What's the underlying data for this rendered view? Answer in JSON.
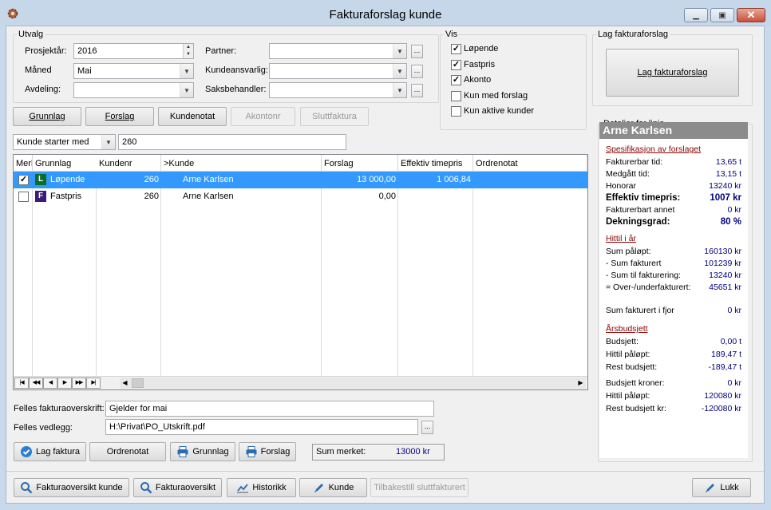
{
  "window": {
    "title": "Fakturaforslag kunde"
  },
  "utvalg": {
    "legend": "Utvalg",
    "prosjektar_label": "Prosjektår:",
    "prosjektar_value": "2016",
    "maned_label": "Måned",
    "maned_value": "Mai",
    "avdeling_label": "Avdeling:",
    "avdeling_value": "",
    "partner_label": "Partner:",
    "partner_value": "",
    "kundeansvarlig_label": "Kundeansvarlig:",
    "kundeansvarlig_value": "",
    "saksbehandler_label": "Saksbehandler:",
    "saksbehandler_value": "",
    "ellipsis": "..."
  },
  "vis": {
    "legend": "Vis",
    "options": [
      {
        "label": "Løpende",
        "checked": true
      },
      {
        "label": "Fastpris",
        "checked": true
      },
      {
        "label": "Akonto",
        "checked": true
      },
      {
        "label": "Kun med forslag",
        "checked": false
      },
      {
        "label": "Kun aktive kunder",
        "checked": false
      }
    ]
  },
  "lag": {
    "legend": "Lag fakturaforslag",
    "button": "Lag fakturaforslag"
  },
  "tabs": {
    "grunnlag": "Grunnlag",
    "forslag": "Forslag",
    "kundenotat": "Kundenotat",
    "akontonr": "Akontonr",
    "sluttfaktura": "Sluttfaktura"
  },
  "filter": {
    "mode": "Kunde starter med",
    "value": "260"
  },
  "grid": {
    "headers": [
      "Merk",
      "Grunnlag",
      "Kundenr",
      ">Kunde",
      "Forslag",
      "Effektiv timepris",
      "Ordrenotat"
    ],
    "rows": [
      {
        "checked": true,
        "tag": "L",
        "tag_color": "#0a6e2a",
        "grunnlag": "Løpende",
        "kundenr": "260",
        "kunde": "Arne Karlsen",
        "forslag": "13 000,00",
        "timepris": "1 006,84",
        "ordrenotat": ""
      },
      {
        "checked": false,
        "tag": "F",
        "tag_color": "#3a1a7a",
        "grunnlag": "Fastpris",
        "kundenr": "260",
        "kunde": "Arne Karlsen",
        "forslag": "0,00",
        "timepris": "",
        "ordrenotat": ""
      }
    ],
    "nav": [
      "|◀",
      "◀◀",
      "◀",
      "▶",
      "▶▶",
      "▶|"
    ]
  },
  "footer_fields": {
    "overskrift_label": "Felles fakturaoverskrift:",
    "overskrift_value": "Gjelder for mai",
    "vedlegg_label": "Felles vedlegg:",
    "vedlegg_value": "H:\\Privat\\PO_Utskrift.pdf"
  },
  "actions": {
    "lag_faktura": "Lag faktura",
    "ordrenotat": "Ordrenotat",
    "grunnlag": "Grunnlag",
    "forslag": "Forslag",
    "sum_label": "Sum merket:",
    "sum_value": "13000 kr"
  },
  "bottom": {
    "fakturaoversikt_kunde": "Fakturaoversikt kunde",
    "fakturaoversikt": "Fakturaoversikt",
    "historikk": "Historikk",
    "kunde": "Kunde",
    "tilbakestill": "Tilbakestill sluttfakturert",
    "lukk": "Lukk"
  },
  "details": {
    "legend": "Detaljer for linje",
    "customer": "Arne Karlsen",
    "spec_title": "Spesifikasjon av forslaget",
    "spec": [
      {
        "label": "Fakturerbar tid:",
        "value": "13,65 t"
      },
      {
        "label": "Medgått tid:",
        "value": "13,15 t"
      },
      {
        "label": "Honorar",
        "value": "13240 kr"
      },
      {
        "label": "Effektiv timepris:",
        "value": "1007 kr"
      },
      {
        "label": "Fakturerbart annet",
        "value": "0 kr"
      },
      {
        "label": "Dekningsgrad:",
        "value": "80 %"
      }
    ],
    "hittil_title": "Hittil i år",
    "hittil": [
      {
        "label": "Sum påløpt:",
        "value": "160130 kr"
      },
      {
        "label": "- Sum fakturert",
        "value": "101239 kr"
      },
      {
        "label": "- Sum til fakturering:",
        "value": "13240 kr"
      },
      {
        "label": "= Over-/underfakturert:",
        "value": "45651 kr"
      }
    ],
    "fjor": {
      "label": "Sum fakturert i fjor",
      "value": "0 kr"
    },
    "budsjett_title": "Årsbudsjett",
    "budsjett": [
      {
        "label": "Budsjett:",
        "value": "0,00 t"
      },
      {
        "label": "Hittil påløpt:",
        "value": "189,47 t"
      },
      {
        "label": "Rest budsjett:",
        "value": "-189,47 t"
      },
      {
        "label": "Budsjett kroner:",
        "value": "0 kr"
      },
      {
        "label": "Hittil påløpt:",
        "value": "120080 kr"
      },
      {
        "label": "Rest budsjett kr:",
        "value": "-120080 kr"
      }
    ]
  }
}
